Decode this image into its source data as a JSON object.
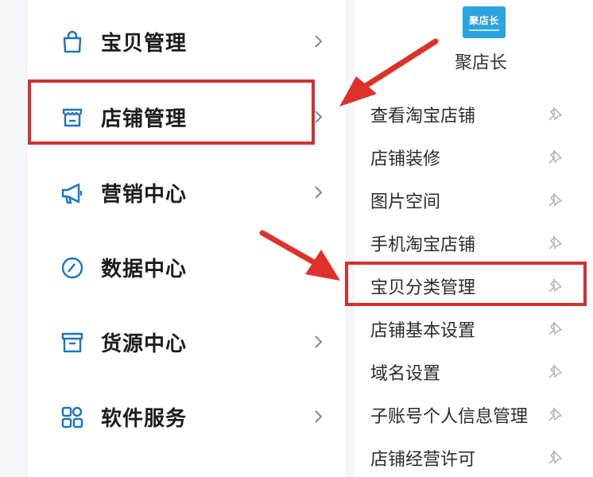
{
  "nav": {
    "items": [
      {
        "label": "宝贝管理",
        "icon": "bag-icon",
        "has_chevron": true
      },
      {
        "label": "店铺管理",
        "icon": "store-icon",
        "has_chevron": true
      },
      {
        "label": "营销中心",
        "icon": "megaphone-icon",
        "has_chevron": true
      },
      {
        "label": "数据中心",
        "icon": "compass-icon",
        "has_chevron": false
      },
      {
        "label": "货源中心",
        "icon": "box-icon",
        "has_chevron": true
      },
      {
        "label": "软件服务",
        "icon": "apps-grid-icon",
        "has_chevron": true
      }
    ]
  },
  "app": {
    "name": "聚店长",
    "logo_text": "聚店长"
  },
  "submenu": {
    "items": [
      {
        "label": "查看淘宝店铺"
      },
      {
        "label": "店铺装修"
      },
      {
        "label": "图片空间"
      },
      {
        "label": "手机淘宝店铺"
      },
      {
        "label": "宝贝分类管理"
      },
      {
        "label": "店铺基本设置"
      },
      {
        "label": "域名设置"
      },
      {
        "label": "子账号个人信息管理"
      },
      {
        "label": "店铺经营许可"
      }
    ]
  },
  "colors": {
    "highlight": "#d4302d",
    "icon": "#1a73c6",
    "logo": "#2aa3e0"
  }
}
